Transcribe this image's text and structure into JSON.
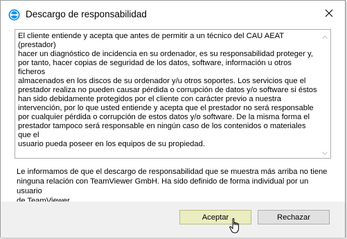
{
  "window": {
    "title": "Descargo de responsabilidad",
    "icon": "teamviewer-icon",
    "close_icon": "close-icon"
  },
  "disclaimer": {
    "text": "El cliente entiende y acepta que antes de permitir a un técnico del CAU AEAT (prestador)\nhacer un diagnóstico de incidencia en su ordenador, es su responsabilidad proteger y,\npor tanto, hacer copias de seguridad de los datos, software, información u otros ficheros\nalmacenados en los discos de su ordenador y/u otros soportes. Los servicios que el\nprestador realiza no pueden causar pérdida o corrupción de datos y/o software si éstos\nhan sido debidamente protegidos por el cliente con carácter previo a nuestra\nintervención, por lo que usted entiende y acepta que el prestador no será responsable\npor cualquier pérdida o corrupción de estos datos y/o software. De la misma forma el\nprestador tampoco será responsable en ningún caso de los contenidos o materiales que el\nusuario pueda poseer en los equipos de su propiedad."
  },
  "notice": {
    "text": "Le informamos de que el descargo de responsabilidad que se muestra más arriba no tiene\nninguna relación con TeamViewer GmbH. Ha sido definido de forma individual por un usuario\nde TeamViewer."
  },
  "buttons": {
    "accept_label": "Aceptar",
    "reject_label": "Rechazar"
  },
  "colors": {
    "accept_bg": "#e9edbf",
    "brand_blue": "#0e8ee9"
  }
}
